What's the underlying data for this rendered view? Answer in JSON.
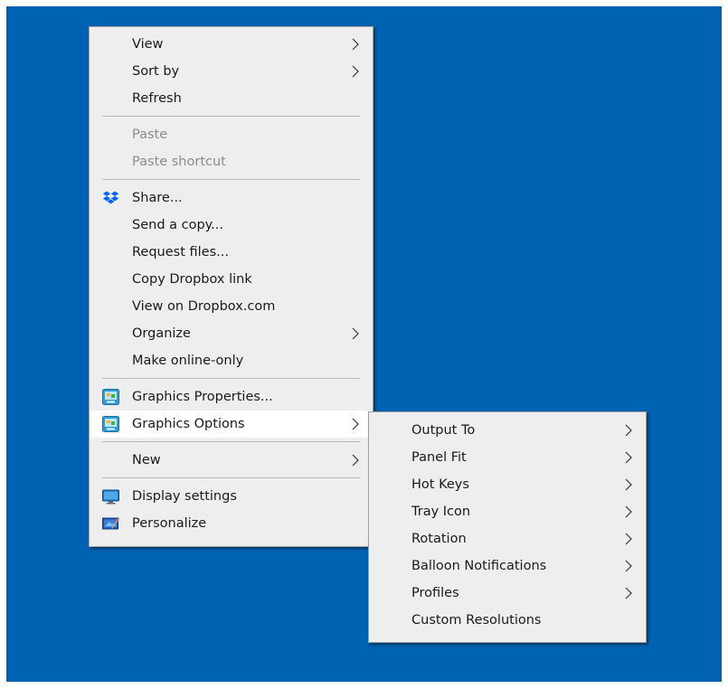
{
  "context_menu": {
    "group1": [
      {
        "label": "View",
        "submenu": true
      },
      {
        "label": "Sort by",
        "submenu": true
      },
      {
        "label": "Refresh"
      }
    ],
    "group2": [
      {
        "label": "Paste",
        "disabled": true
      },
      {
        "label": "Paste shortcut",
        "disabled": true
      }
    ],
    "group3": [
      {
        "label": "Share...",
        "icon": "dropbox-icon"
      },
      {
        "label": "Send a copy..."
      },
      {
        "label": "Request files..."
      },
      {
        "label": "Copy Dropbox link"
      },
      {
        "label": "View on Dropbox.com"
      },
      {
        "label": "Organize",
        "submenu": true
      },
      {
        "label": "Make online-only"
      }
    ],
    "group4": [
      {
        "label": "Graphics Properties...",
        "icon": "intel-graphics-icon"
      },
      {
        "label": "Graphics Options",
        "icon": "intel-graphics-icon",
        "submenu": true,
        "highlighted": true
      }
    ],
    "group5": [
      {
        "label": "New",
        "submenu": true
      }
    ],
    "group6": [
      {
        "label": "Display settings",
        "icon": "display-icon"
      },
      {
        "label": "Personalize",
        "icon": "personalize-icon"
      }
    ]
  },
  "graphics_options_submenu": [
    {
      "label": "Output To",
      "submenu": true
    },
    {
      "label": "Panel Fit",
      "submenu": true
    },
    {
      "label": "Hot Keys",
      "submenu": true
    },
    {
      "label": "Tray Icon",
      "submenu": true
    },
    {
      "label": "Rotation",
      "submenu": true
    },
    {
      "label": "Balloon Notifications",
      "submenu": true
    },
    {
      "label": "Profiles",
      "submenu": true
    },
    {
      "label": "Custom Resolutions"
    }
  ],
  "colors": {
    "desktop": "#0062b2",
    "menu_background": "#eeeeee",
    "highlight": "#ffffff",
    "disabled_text": "#8c8c8c"
  }
}
